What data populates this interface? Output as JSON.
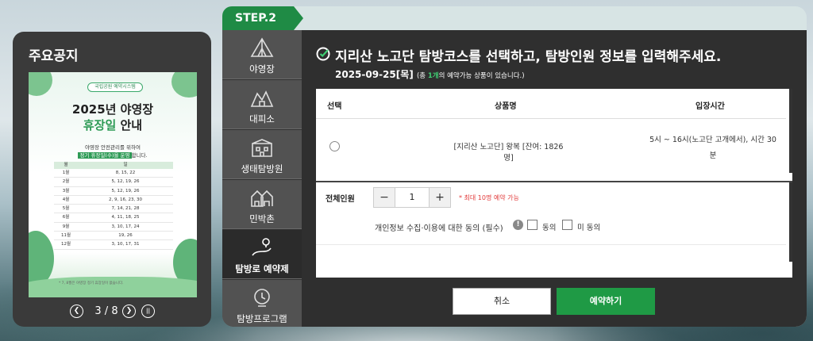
{
  "notice": {
    "title": "주요공지",
    "poster": {
      "tag": "국립공원 예약시스템",
      "title_line1": "2025년 야영장",
      "title_line2_highlight": "휴장일",
      "title_line2_rest": " 안내",
      "sub1": "야영장 안전관리를 위하여",
      "sub2_highlight": "정기 휴장일(수)을 운영",
      "sub2_rest": "합니다.",
      "table_headers": [
        "월",
        "일"
      ],
      "rows": [
        [
          "1월",
          "8, 15, 22"
        ],
        [
          "2월",
          "5, 12, 19, 26"
        ],
        [
          "3월",
          "5, 12, 19, 26"
        ],
        [
          "4월",
          "2, 9, 16, 23, 30"
        ],
        [
          "5월",
          "7, 14, 21, 28"
        ],
        [
          "6월",
          "4, 11, 18, 25"
        ],
        [
          "9월",
          "3, 10, 17, 24"
        ],
        [
          "11월",
          "19, 26"
        ],
        [
          "12월",
          "3, 10, 17, 31"
        ]
      ],
      "note": "* 7, 8월은 야영장 정기 휴장일이 없습니다."
    },
    "pager": {
      "prev_icon": "chevron-left-icon",
      "text": "3 / 8",
      "next_icon": "chevron-right-icon",
      "pause_icon": "pause-icon"
    }
  },
  "step": {
    "label": "STEP.2"
  },
  "sidebar": {
    "items": [
      {
        "label": "야영장",
        "icon": "tent-icon",
        "active": false
      },
      {
        "label": "대피소",
        "icon": "shelter-icon",
        "active": false
      },
      {
        "label": "생태탐방원",
        "icon": "building-icon",
        "active": false
      },
      {
        "label": "민박촌",
        "icon": "houses-icon",
        "active": false
      },
      {
        "label": "탐방로 예약제",
        "icon": "trail-icon",
        "active": true
      },
      {
        "label": "탐방프로그램",
        "icon": "program-icon",
        "active": false
      }
    ]
  },
  "main": {
    "heading": "지리산 노고단 탐방코스를 선택하고, 탐방인원 정보를 입력해주세요.",
    "date": "2025-09-25[목]",
    "date_note_pre": "(총 ",
    "date_note_count": "1개",
    "date_note_post": "의 예약가능 상품이 있습니다.)",
    "table": {
      "headers": {
        "select": "선택",
        "product": "상품명",
        "time": "입장시간"
      },
      "rows": [
        {
          "product": "[지리산 노고단] 왕복 [잔여: 1826명]",
          "time_line1": "5시 ~ 16시(노고단 고개에서), 시간 30",
          "time_line2": "분"
        }
      ]
    },
    "form": {
      "label": "전체인원",
      "minus": "−",
      "value": "1",
      "plus": "+",
      "max_note": "* 최대 10명 예약 가능",
      "consent_label": "개인정보 수집·이용에 대한 동의 (필수)",
      "info_icon": "info-icon",
      "agree": "동의",
      "disagree": "미 동의"
    },
    "buttons": {
      "cancel": "취소",
      "reserve": "예약하기"
    }
  },
  "colors": {
    "accent": "#1f9a45",
    "step": "#1f8b45",
    "panel": "#2f2f2f",
    "nav": "#525252",
    "warning": "#e23b3b"
  }
}
